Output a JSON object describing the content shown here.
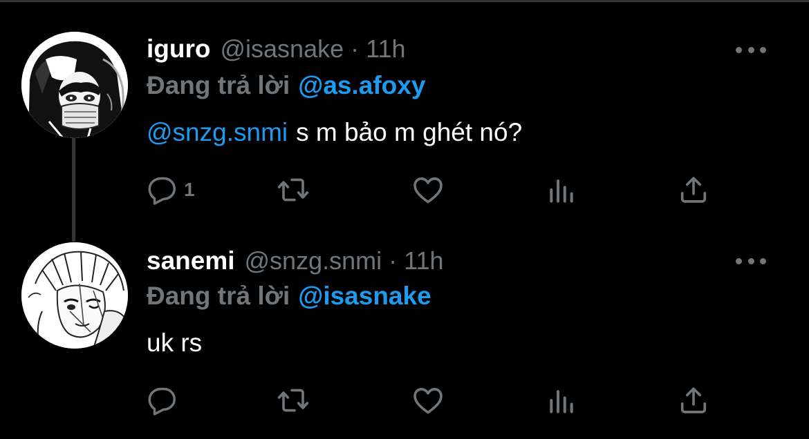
{
  "tweets": [
    {
      "display_name": "iguro",
      "handle": "@isasnake",
      "separator": "·",
      "time": "11h",
      "reply_prefix": "Đang trả lời",
      "reply_to": "@as.afoxy",
      "body_mention": "@snzg.snmi",
      "body_text": "s m bảo m ghét nó?",
      "reply_count": "1",
      "avatar_icon": "manga-avatar-masked-character"
    },
    {
      "display_name": "sanemi",
      "handle": "@snzg.snmi",
      "separator": "·",
      "time": "11h",
      "reply_prefix": "Đang trả lời",
      "reply_to": "@isasnake",
      "body_mention": "",
      "body_text": "uk rs",
      "reply_count": "",
      "avatar_icon": "manga-avatar-scarred-character"
    }
  ],
  "icons": {
    "reply": "reply-bubble-icon",
    "retweet": "retweet-icon",
    "like": "heart-icon",
    "stats": "analytics-icon",
    "share": "share-icon",
    "more": "more-dots-icon"
  },
  "colors": {
    "background": "#000000",
    "text_primary": "#ffffff",
    "text_secondary": "#71767b",
    "accent": "#1d9bf0",
    "thread_line": "#333639"
  }
}
